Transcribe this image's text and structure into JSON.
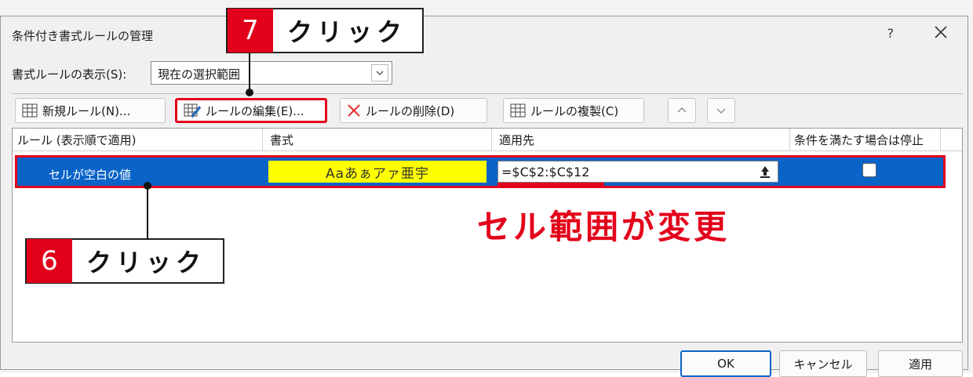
{
  "dialog": {
    "title": "条件付き書式ルールの管理",
    "help": "?",
    "show_rules_label": "書式ルールの表示(S):",
    "show_rules_value": "現在の選択範囲"
  },
  "toolbar": {
    "new_rule": "新規ルール(N)...",
    "edit_rule": "ルールの編集(E)...",
    "delete_rule": "ルールの削除(D)",
    "duplicate_rule": "ルールの複製(C)"
  },
  "columns": {
    "rule": "ルール (表示順で適用)",
    "format": "書式",
    "applies_to": "適用先",
    "stop_if_true": "条件を満たす場合は停止"
  },
  "rules": [
    {
      "name": "セルが空白の値",
      "format_preview": "Aaあぁアァ亜宇",
      "applies_to": "=$C$2:$C$12",
      "stop_if_true": false
    }
  ],
  "footer": {
    "ok": "OK",
    "cancel": "キャンセル",
    "apply": "適用"
  },
  "annotations": {
    "step7_number": "7",
    "step7_text": "クリック",
    "step6_number": "6",
    "step6_text": "クリック",
    "note": "セル範囲が変更"
  },
  "colors": {
    "accent_red": "#e3001b",
    "selection_blue": "#0a64c8",
    "format_fill": "#ffff00"
  },
  "icons": [
    "close-icon",
    "chevron-down-icon",
    "new-rule-icon",
    "edit-rule-icon",
    "delete-icon",
    "duplicate-rule-icon",
    "move-up-icon",
    "move-down-icon",
    "collapse-range-icon"
  ]
}
